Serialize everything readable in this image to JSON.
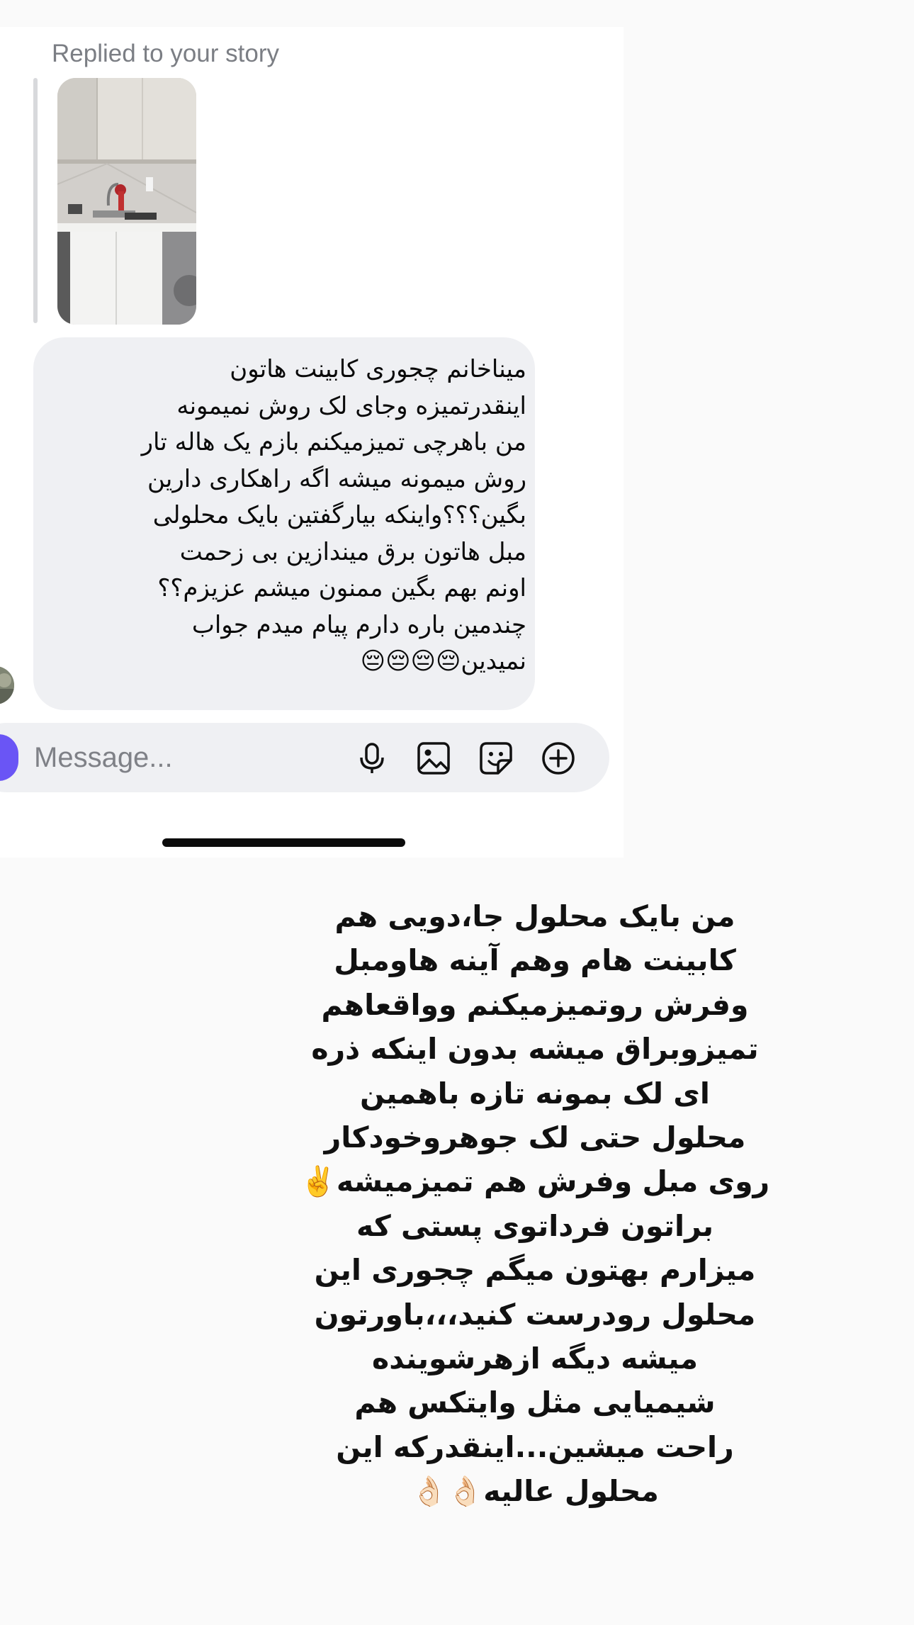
{
  "story_reply": {
    "label": "Replied to your story",
    "thumbnail_icon": "story-thumbnail-kitchen"
  },
  "message": {
    "lines": [
      "میناخانم چجوری کابینت هاتون",
      "اینقدرتمیزه وجای لک روش نمیمونه",
      "من باهرچی تمیزمیکنم بازم یک هاله تار",
      "روش میمونه میشه اگه راهکاری دارین",
      "بگین؟؟؟واینکه بیارگفتین بایک محلولی",
      "مبل هاتون برق میندازین بی زحمت",
      "اونم بهم بگین ممنون میشم عزیزم؟؟",
      "چندمین باره دارم پیام میدم جواب",
      "نمیدین😔😔😔😔"
    ]
  },
  "composer": {
    "placeholder": "Message...",
    "value": "",
    "icons": [
      "camera-icon",
      "microphone-icon",
      "gallery-icon",
      "sticker-icon",
      "plus-icon"
    ],
    "accent_color": "#6a55f5"
  },
  "caption": {
    "lines": [
      "من بایک محلول جا،دویی هم",
      "کابینت هام وهم آینه هاومبل",
      "وفرش روتمیزمیکنم وواقعاهم",
      "تمیزوبراق میشه بدون اینکه ذره",
      "ای لک بمونه تازه باهمین",
      "محلول حتی لک جوهروخودکار",
      "روی مبل وفرش هم تمیزمیشه✌️",
      "براتون فرداتوی پستی که",
      "میزارم بهتون میگم چجوری این",
      "محلول رودرست کنید،،،باورتون",
      "میشه دیگه ازهرشوینده",
      "شیمیایی مثل وایتکس هم",
      "راحت میشین...اینقدرکه این",
      "محلول عالیه👌🏻👌🏻"
    ]
  }
}
